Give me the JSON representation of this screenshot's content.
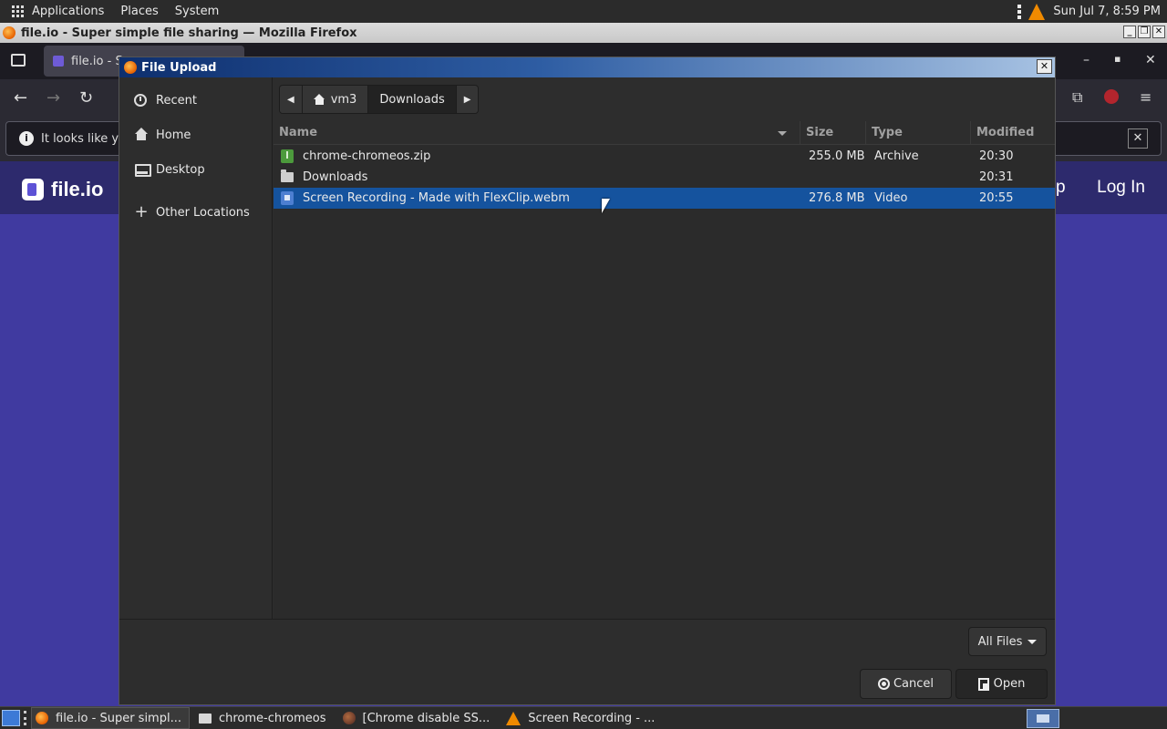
{
  "top_panel": {
    "menu": [
      "Applications",
      "Places",
      "System"
    ],
    "clock": "Sun Jul 7,  8:59 PM"
  },
  "firefox": {
    "window_title": "file.io - Super simple file sharing — Mozilla Firefox",
    "tab_title": "file.io - S",
    "notice_text": "It looks like yo",
    "site_logo": "file.io",
    "site_partial": "p",
    "site_login": "Log In",
    "notice_close": "✕"
  },
  "dialog": {
    "title": "File Upload",
    "close": "✕",
    "sidebar": [
      {
        "label": "Recent"
      },
      {
        "label": "Home"
      },
      {
        "label": "Desktop"
      },
      {
        "label": "Other Locations"
      }
    ],
    "pathbar": {
      "back": "◀",
      "home_label": "vm3",
      "current": "Downloads",
      "forward": "▶"
    },
    "columns": {
      "name": "Name",
      "size": "Size",
      "type": "Type",
      "modified": "Modified"
    },
    "files": [
      {
        "name": "chrome-chromeos.zip",
        "size": "255.0 MB",
        "type": "Archive",
        "modified": "20:30",
        "icon": "zip-icon"
      },
      {
        "name": "Downloads",
        "size": "",
        "type": "",
        "modified": "20:31",
        "icon": "folder-icon"
      },
      {
        "name": "Screen Recording - Made with FlexClip.webm",
        "size": "276.8 MB",
        "type": "Video",
        "modified": "20:55",
        "icon": "video-icon",
        "selected": true
      }
    ],
    "filter": "All Files",
    "cancel": "Cancel",
    "open": "Open"
  },
  "taskbar": {
    "items": [
      {
        "label": "file.io - Super simpl..."
      },
      {
        "label": "chrome-chromeos"
      },
      {
        "label": "[Chrome disable SS..."
      },
      {
        "label": "Screen Recording - ..."
      }
    ]
  },
  "colors": {
    "selection": "#15539e",
    "site_purple": "#403aa0",
    "dialog_bg": "#2d2d2d"
  }
}
